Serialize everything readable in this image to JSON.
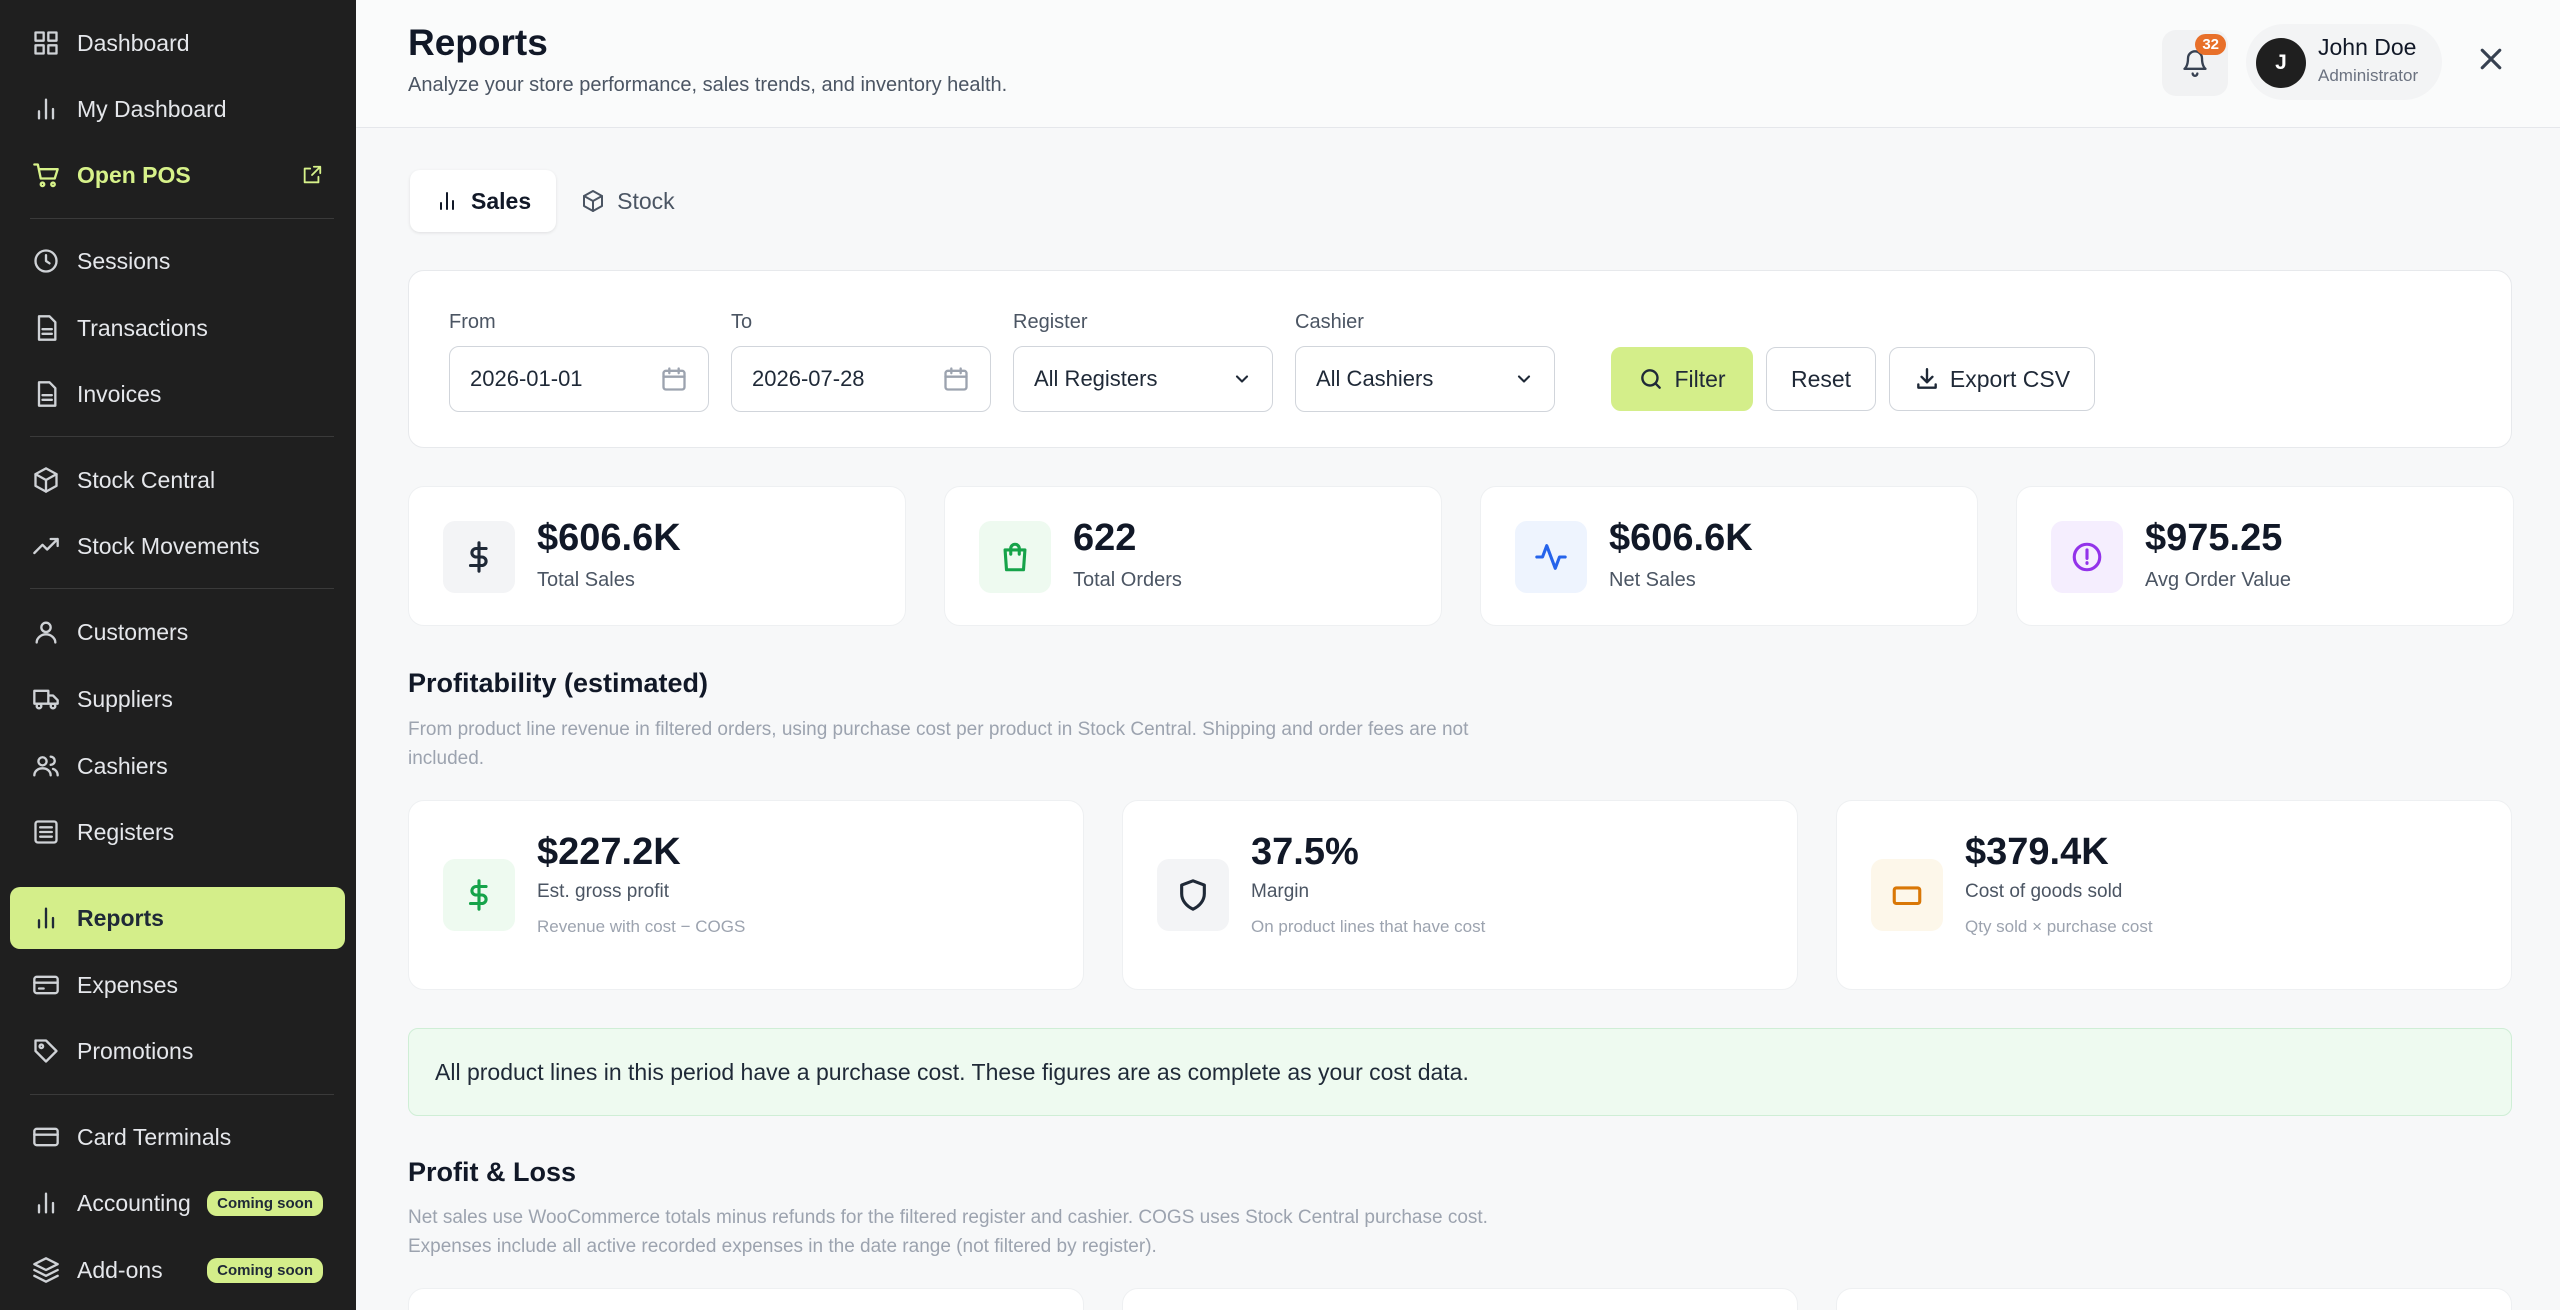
{
  "sidebar": {
    "items": [
      {
        "label": "Dashboard",
        "icon": "grid-icon"
      },
      {
        "label": "My Dashboard",
        "icon": "bar-chart-icon"
      },
      {
        "label": "Open POS",
        "icon": "cart-icon"
      },
      {
        "label": "Sessions",
        "icon": "clock-icon"
      },
      {
        "label": "Transactions",
        "icon": "document-icon"
      },
      {
        "label": "Invoices",
        "icon": "document-icon"
      },
      {
        "label": "Stock Central",
        "icon": "box-icon"
      },
      {
        "label": "Stock Movements",
        "icon": "trend-up-icon"
      },
      {
        "label": "Customers",
        "icon": "user-icon"
      },
      {
        "label": "Suppliers",
        "icon": "truck-icon"
      },
      {
        "label": "Cashiers",
        "icon": "users-icon"
      },
      {
        "label": "Registers",
        "icon": "list-icon"
      },
      {
        "label": "Reports",
        "icon": "bar-chart-icon"
      },
      {
        "label": "Expenses",
        "icon": "wallet-icon"
      },
      {
        "label": "Promotions",
        "icon": "tag-icon"
      },
      {
        "label": "Card Terminals",
        "icon": "card-icon"
      },
      {
        "label": "Accounting",
        "icon": "bar-chart-icon",
        "badge": "Coming soon"
      },
      {
        "label": "Add-ons",
        "icon": "layers-icon",
        "badge": "Coming soon"
      }
    ],
    "active": "Reports",
    "accent": "#d4ee8a"
  },
  "header": {
    "title": "Reports",
    "subtitle": "Analyze your store performance, sales trends, and inventory health.",
    "notification_count": "32",
    "user": {
      "initial": "J",
      "name": "John Doe",
      "role": "Administrator"
    }
  },
  "tabs": [
    {
      "label": "Sales",
      "active": true
    },
    {
      "label": "Stock",
      "active": false
    }
  ],
  "filters": {
    "from": {
      "label": "From",
      "value": "2026-01-01"
    },
    "to": {
      "label": "To",
      "value": "2026-07-28"
    },
    "register": {
      "label": "Register",
      "value": "All Registers"
    },
    "cashier": {
      "label": "Cashier",
      "value": "All Cashiers"
    },
    "filter_label": "Filter",
    "reset_label": "Reset",
    "export_label": "Export CSV"
  },
  "kpis": [
    {
      "value": "$606.6K",
      "label": "Total Sales",
      "icon": "dollar-icon",
      "color": "#1f2937"
    },
    {
      "value": "622",
      "label": "Total Orders",
      "icon": "shopping-bag-icon",
      "color": "#16a34a"
    },
    {
      "value": "$606.6K",
      "label": "Net Sales",
      "icon": "activity-icon",
      "color": "#2563eb"
    },
    {
      "value": "$975.25",
      "label": "Avg Order Value",
      "icon": "info-circle-icon",
      "color": "#9333ea"
    }
  ],
  "profitability": {
    "title": "Profitability (estimated)",
    "desc_line1": "From product line revenue in filtered orders, using purchase cost per product in Stock Central. Shipping and order fees are not",
    "desc_line2": "included.",
    "cards": [
      {
        "value": "$227.2K",
        "label": "Est. gross profit",
        "sub": "Revenue with cost − COGS",
        "icon": "dollar-icon"
      },
      {
        "value": "37.5%",
        "label": "Margin",
        "sub": "On product lines that have cost",
        "icon": "shield-icon"
      },
      {
        "value": "$379.4K",
        "label": "Cost of goods sold",
        "sub": "Qty sold × purchase cost",
        "icon": "rectangle-icon"
      }
    ],
    "notice": "All product lines in this period have a purchase cost. These figures are as complete as your cost data."
  },
  "pnl": {
    "title": "Profit & Loss",
    "desc_line1": "Net sales use WooCommerce totals minus refunds for the filtered register and cashier. COGS uses Stock Central purchase cost.",
    "desc_line2": "Expenses include all active recorded expenses in the date range (not filtered by register)."
  }
}
